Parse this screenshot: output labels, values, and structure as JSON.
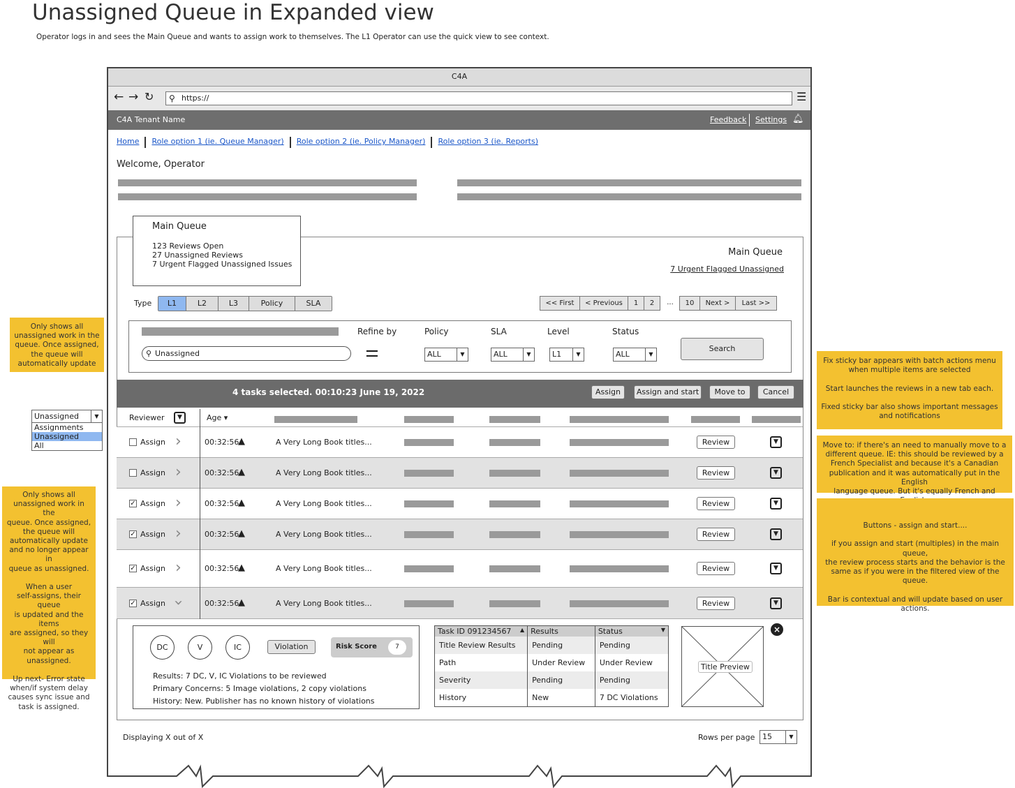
{
  "page": {
    "title": "Unassigned Queue in Expanded view",
    "subtitle": "Operator logs in and sees the Main Queue and wants to assign work to themselves.   The L1 Operator can use the quick view to see context."
  },
  "browser": {
    "title": "C4A",
    "url": "https://"
  },
  "header": {
    "tenant": "C4A Tenant Name",
    "feedback": "Feedback",
    "settings": "Settings"
  },
  "nav": [
    "Home",
    "Role option 1 (ie. Queue Manager)",
    "Role option 2 (ie. Policy Manager)",
    "Role option 3 (ie. Reports)"
  ],
  "welcome": "Welcome, Operator",
  "card": {
    "title": "Main Queue",
    "line1": "123  Reviews Open",
    "line2": "27 Unassigned Reviews",
    "line3": "7 Urgent Flagged Unassigned Issues"
  },
  "panel": {
    "title": "Main Queue",
    "urgent_link": "7 Urgent Flagged Unassigned"
  },
  "type": {
    "label": "Type",
    "options": [
      "L1",
      "L2",
      "L3",
      "Policy",
      "SLA"
    ],
    "selected": "L1"
  },
  "pagination": [
    "<< First",
    "< Previous",
    "1",
    "2",
    "...",
    "10",
    "Next >",
    "Last >>"
  ],
  "filters": {
    "search_value": "Unassigned",
    "refine": "Refine by",
    "policy": {
      "label": "Policy",
      "value": "ALL"
    },
    "sla": {
      "label": "SLA",
      "value": "ALL"
    },
    "level": {
      "label": "Level",
      "value": "L1"
    },
    "status": {
      "label": "Status",
      "value": "ALL"
    },
    "search_button": "Search"
  },
  "sticky": {
    "message": "4 tasks selected.   00:10:23 June 19, 2022",
    "assign": "Assign",
    "assign_start": "Assign and start",
    "move": "Move to",
    "cancel": "Cancel"
  },
  "table": {
    "col_reviewer": "Reviewer",
    "col_age": "Age",
    "rows": [
      {
        "checked": false,
        "assign": "Assign",
        "age": "00:32:56",
        "title": "A Very Long Book titles...",
        "review": "Review",
        "expanded": false
      },
      {
        "checked": false,
        "assign": "Assign",
        "age": "00:32:56",
        "title": "A Very Long Book titles...",
        "review": "Review",
        "expanded": false
      },
      {
        "checked": true,
        "assign": "Assign",
        "age": "00:32:56",
        "title": "A Very Long Book titles...",
        "review": "Review",
        "expanded": false
      },
      {
        "checked": true,
        "assign": "Assign",
        "age": "00:32:56",
        "title": "A Very Long Book titles...",
        "review": "Review",
        "expanded": false
      },
      {
        "checked": true,
        "assign": "Assign",
        "age": "00:32:56",
        "title": "A Very Long Book titles...",
        "review": "Review",
        "expanded": false
      },
      {
        "checked": true,
        "assign": "Assign",
        "age": "00:32:56",
        "title": "A Very Long Book titles...",
        "review": "Review",
        "expanded": true
      }
    ]
  },
  "detail": {
    "badges": [
      "DC",
      "V",
      "IC"
    ],
    "violation": "Violation",
    "risk_label": "Risk Score",
    "risk_value": "7",
    "results": "Results:  7 DC, V, IC Violations to be reviewed",
    "concerns": "Primary Concerns:   5 Image violations, 2 copy violations",
    "history": "History:  New.  Publisher has no known history of violations",
    "grid": {
      "headers": [
        "Task ID 091234567",
        "Results",
        "Status"
      ],
      "rows": [
        [
          "Title Review Results",
          "Pending",
          "Pending"
        ],
        [
          "Path",
          "Under Review",
          "Under Review"
        ],
        [
          "Severity",
          "Pending",
          "Pending"
        ],
        [
          "History",
          "New",
          "7 DC Violations"
        ]
      ]
    },
    "preview": "Title Preview"
  },
  "footer": {
    "display": "Displaying X out of X",
    "rows_label": "Rows per page",
    "rows_value": "15"
  },
  "side_dropdown": {
    "value": "Unassigned",
    "options": [
      "Assignments",
      "Unassigned",
      "All"
    ],
    "highlighted": "Unassigned"
  },
  "notes": {
    "left1": "Only shows all\nunassigned work in the\nqueue.  Once assigned,\nthe queue will\nautomatically update",
    "left2": "Only shows all\nunassigned work in the\nqueue.  Once assigned,\nthe queue will\nautomatically update\nand no longer appear in\nqueue as unassigned.\n\nWhen a user\nself-assigns, their queue\nis updated and the items\nare assigned, so they will\nnot appear as\nunassigned.\n\nUp next- Error state\nwhen/if system delay\ncauses sync issue and\ntask is assigned.",
    "right1": "Fix sticky bar appears with batch actions menu\nwhen multiple items are selected\n\nStart launches the reviews in a new tab each.\n\nFixed sticky bar also shows important messages\nand notifications",
    "right2": "Move to:  if there's an need to manually move to a\ndifferent queue.   IE: this should be reviewed by a\nFrench Specialist and because it's a Canadian\npublication and it was automatically put in the English\nlanguage queue. But it's equally French and English.",
    "right3": "Buttons - assign and start....\n\nif you assign and start (multiples) in the main queue,\nthe review process starts and the behavior is the\nsame as if you were in the filtered view of the queue.\n\nBar is contextual and will update based on user\nactions."
  },
  "colors": {
    "note": "#f3c130",
    "sticky": "#6b6b6b",
    "selected": "#8fb8f0",
    "link": "#1a56c8"
  }
}
